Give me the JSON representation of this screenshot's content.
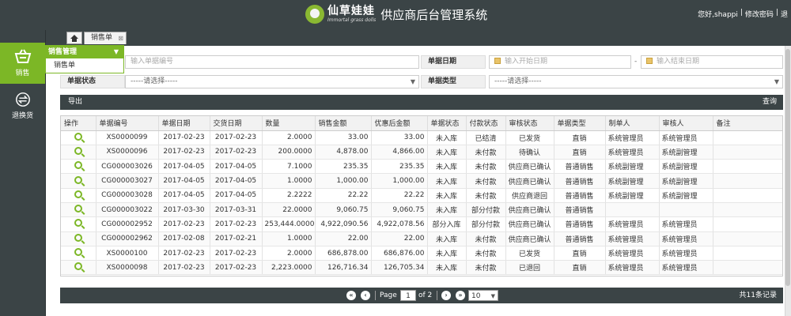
{
  "header": {
    "brand_cn": "仙草娃娃",
    "brand_en": "Immortal grass dolls",
    "system_title": "供应商后台管理系统",
    "greeting": "您好,shappi",
    "divider": "|",
    "change_password": "修改密码",
    "logout_divider": "|",
    "logout": "退"
  },
  "sidebar": {
    "items": [
      {
        "label": "销售"
      },
      {
        "label": "退换货"
      }
    ]
  },
  "menu": {
    "title": "销售管理",
    "items": [
      {
        "label": "销售单"
      }
    ]
  },
  "tabs": {
    "doc_tab": "销售单"
  },
  "filters": {
    "doc_no_placeholder": "输入单据编号",
    "doc_date_label": "单据日期",
    "start_date_placeholder": "输入开始日期",
    "date_sep": "-",
    "end_date_placeholder": "输入结束日期",
    "doc_status_label": "单据状态",
    "doc_status_value": "-----请选择-----",
    "doc_type_label": "单据类型",
    "doc_type_value": "-----请选择-----"
  },
  "toolbar": {
    "export": "导出",
    "query": "查询"
  },
  "table": {
    "columns": [
      "操作",
      "单据编号",
      "单据日期",
      "交货日期",
      "数量",
      "销售金额",
      "优惠后金额",
      "单据状态",
      "付款状态",
      "审核状态",
      "单据类型",
      "制单人",
      "审核人",
      "备注"
    ],
    "rows": [
      [
        "XS0000099",
        "2017-02-23",
        "2017-02-23",
        "2.0000",
        "33.00",
        "33.00",
        "未入库",
        "已结清",
        "已发货",
        "直销",
        "系统管理员",
        "系统管理员",
        ""
      ],
      [
        "XS0000096",
        "2017-02-23",
        "2017-02-23",
        "200.0000",
        "4,878.00",
        "4,866.00",
        "未入库",
        "未付款",
        "待确认",
        "直销",
        "系统管理员",
        "系统副管理",
        ""
      ],
      [
        "CG000003026",
        "2017-04-05",
        "2017-04-05",
        "7.1000",
        "235.35",
        "235.35",
        "未入库",
        "未付款",
        "供应商已确认",
        "普通销售",
        "系统副管理",
        "系统副管理",
        ""
      ],
      [
        "CG000003027",
        "2017-04-05",
        "2017-04-05",
        "1.0000",
        "1,000.00",
        "1,000.00",
        "未入库",
        "未付款",
        "供应商已确认",
        "普通销售",
        "系统副管理",
        "系统副管理",
        ""
      ],
      [
        "CG000003028",
        "2017-04-05",
        "2017-04-05",
        "2.2222",
        "22.22",
        "22.22",
        "未入库",
        "未付款",
        "供应商退回",
        "普通销售",
        "系统副管理",
        "系统副管理",
        ""
      ],
      [
        "CG000003022",
        "2017-03-30",
        "2017-03-31",
        "22.0000",
        "9,060.75",
        "9,060.75",
        "未入库",
        "部分付款",
        "供应商已确认",
        "普通销售",
        "",
        "",
        ""
      ],
      [
        "CG000002952",
        "2017-02-23",
        "2017-02-23",
        "253,444.0000",
        "4,922,090.56",
        "4,922,078.56",
        "部分入库",
        "部分付款",
        "供应商已确认",
        "普通销售",
        "系统管理员",
        "系统管理员",
        ""
      ],
      [
        "CG000002962",
        "2017-02-08",
        "2017-02-21",
        "1.0000",
        "22.00",
        "22.00",
        "未入库",
        "未付款",
        "供应商已确认",
        "普通销售",
        "系统管理员",
        "系统管理员",
        ""
      ],
      [
        "XS0000100",
        "2017-02-23",
        "2017-02-23",
        "2.0000",
        "686,878.00",
        "686,876.00",
        "未入库",
        "未付款",
        "已发货",
        "直销",
        "系统管理员",
        "系统管理员",
        ""
      ],
      [
        "XS0000098",
        "2017-02-23",
        "2017-02-23",
        "2,223.0000",
        "126,716.34",
        "126,705.34",
        "未入库",
        "未付款",
        "已退回",
        "直销",
        "系统管理员",
        "系统管理员",
        ""
      ]
    ]
  },
  "pager": {
    "page_label": "Page",
    "current_page": "1",
    "of_label": "of 2",
    "page_size": "10",
    "total": "共11条记录"
  }
}
